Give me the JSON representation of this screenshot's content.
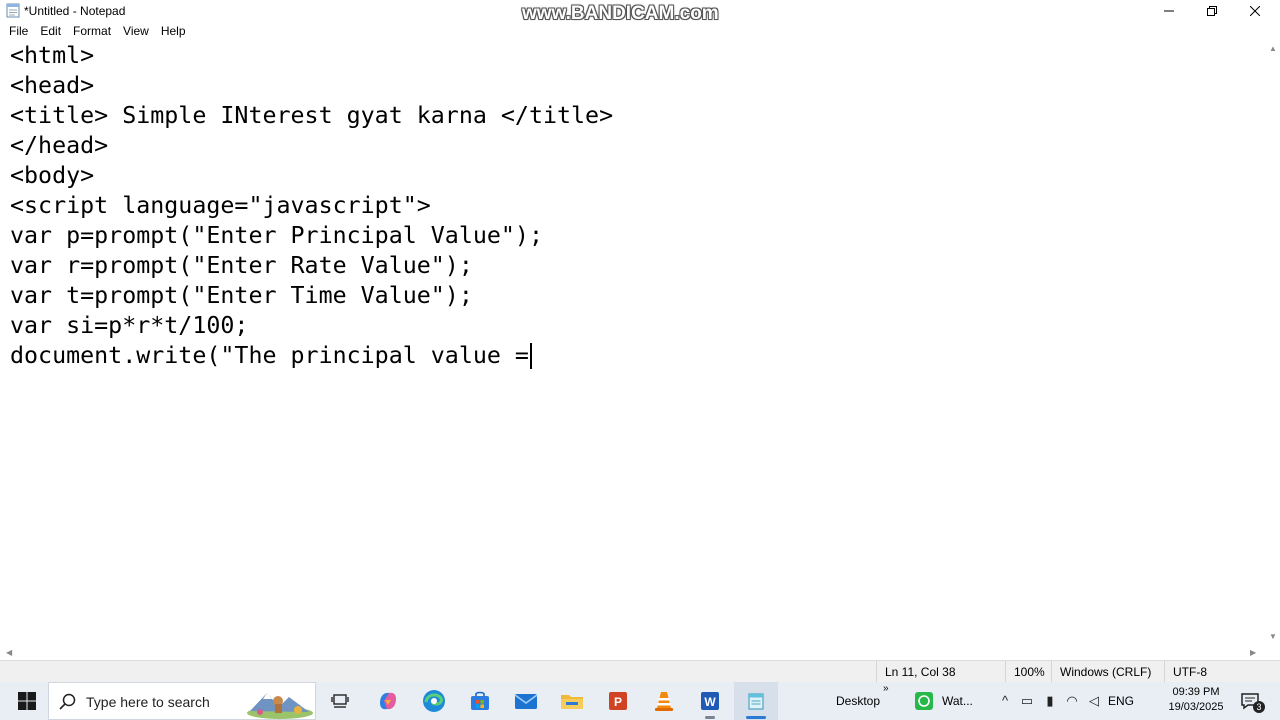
{
  "window": {
    "title": "*Untitled - Notepad",
    "watermark": "www.BANDICAM.com"
  },
  "menu": [
    "File",
    "Edit",
    "Format",
    "View",
    "Help"
  ],
  "editor": {
    "lines": [
      "<html>",
      "<head>",
      "<title> Simple INterest gyat karna </title>",
      "</head>",
      "<body>",
      "<script language=\"javascript\">",
      "var p=prompt(\"Enter Principal Value\");",
      "var r=prompt(\"Enter Rate Value\");",
      "var t=prompt(\"Enter Time Value\");",
      "var si=p*r*t/100;",
      "document.write(\"The principal value ="
    ]
  },
  "status": {
    "position": "Ln 11, Col 38",
    "zoom": "100%",
    "line_ending": "Windows (CRLF)",
    "encoding": "UTF-8"
  },
  "taskbar": {
    "search_placeholder": "Type here to search",
    "desktop_label": "Desktop",
    "whatsapp_label": "Wat...",
    "language": "ENG",
    "time": "09:39 PM",
    "date": "19/03/2025",
    "notification_count": "3"
  },
  "colors": {
    "taskbar_bg": "#e9eef5",
    "status_bg": "#f0f0f0",
    "accent": "#2a7bd6"
  }
}
